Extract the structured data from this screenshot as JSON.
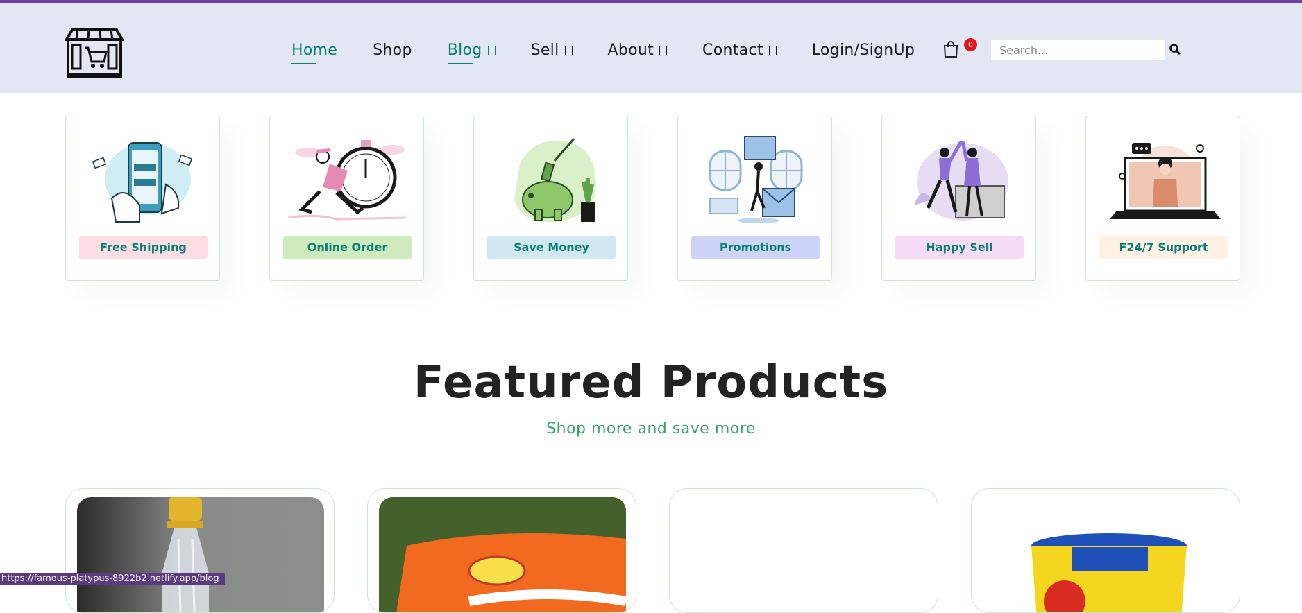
{
  "header": {
    "logo_icon": "store-cart-icon",
    "nav": [
      {
        "label": "Home",
        "dropdown": false
      },
      {
        "label": "Shop",
        "dropdown": false
      },
      {
        "label": "Blog",
        "dropdown": true
      },
      {
        "label": "Sell",
        "dropdown": true
      },
      {
        "label": "About",
        "dropdown": true
      },
      {
        "label": "Contact",
        "dropdown": true
      },
      {
        "label": "Login/SignUp",
        "dropdown": false
      }
    ],
    "cart_count": "0",
    "search_placeholder": "Search..."
  },
  "features": [
    {
      "label": "Free Shipping",
      "color": "#fddde4"
    },
    {
      "label": "Online Order",
      "color": "#cdebbc"
    },
    {
      "label": "Save Money",
      "color": "#d1e8f2"
    },
    {
      "label": "Promotions",
      "color": "#cdd4f8"
    },
    {
      "label": "Happy Sell",
      "color": "#f6dbf6"
    },
    {
      "label": "F24/7 Support",
      "color": "#fff2e5"
    }
  ],
  "featured": {
    "title": "Featured Products",
    "subtitle": "Shop more and save more"
  },
  "status_bar": {
    "url": "https://famous-platypus-8922b2.netlify.app/blog"
  },
  "colors": {
    "accent": "#088178",
    "header_bg": "#e3e6f3",
    "top_strip": "#6a3fa0",
    "badge": "#e8101a"
  }
}
